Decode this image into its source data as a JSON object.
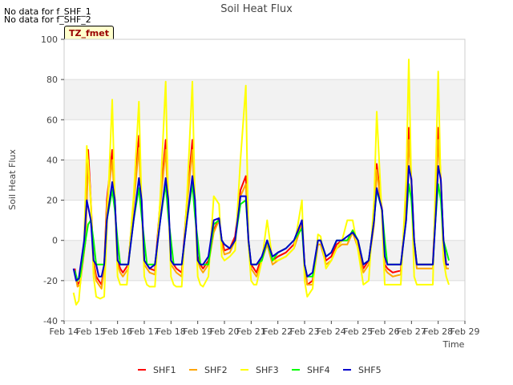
{
  "notes": [
    "No data for f_SHF_1",
    "No data for f_SHF_2"
  ],
  "badge": "TZ_fmet",
  "chart_data": {
    "type": "line",
    "title": "Soil Heat Flux",
    "xlabel": "Time",
    "ylabel": "Soil Heat Flux",
    "ylim": [
      -40,
      100
    ],
    "yticks": [
      -40,
      -20,
      0,
      20,
      40,
      60,
      80,
      100
    ],
    "xlim": [
      0,
      15
    ],
    "xticks": [
      0,
      1,
      2,
      3,
      4,
      5,
      6,
      7,
      8,
      9,
      10,
      11,
      12,
      13,
      14,
      15
    ],
    "xticklabels": [
      "Feb 14",
      "Feb 15",
      "Feb 16",
      "Feb 17",
      "Feb 18",
      "Feb 19",
      "Feb 20",
      "Feb 21",
      "Feb 22",
      "Feb 23",
      "Feb 24",
      "Feb 25",
      "Feb 26",
      "Feb 27",
      "Feb 28",
      "Feb 29"
    ],
    "grid": "horizontal bands",
    "legend_position": "bottom",
    "series": [
      {
        "name": "SHF1",
        "color": "#ff0000",
        "x": [
          0.4,
          0.5,
          0.6,
          0.8,
          0.9,
          1.0,
          1.1,
          1.2,
          1.3,
          1.4,
          1.5,
          1.6,
          1.8,
          1.9,
          2.0,
          2.1,
          2.2,
          2.4,
          2.6,
          2.8,
          2.9,
          3.0,
          3.1,
          3.2,
          3.4,
          3.6,
          3.8,
          3.9,
          4.0,
          4.1,
          4.2,
          4.4,
          4.6,
          4.8,
          4.9,
          5.0,
          5.1,
          5.2,
          5.4,
          5.6,
          5.8,
          5.9,
          6.0,
          6.2,
          6.4,
          6.6,
          6.8,
          6.9,
          7.0,
          7.1,
          7.2,
          7.4,
          7.6,
          7.8,
          8.0,
          8.3,
          8.6,
          8.9,
          9.0,
          9.1,
          9.3,
          9.5,
          9.6,
          9.8,
          10.0,
          10.2,
          10.4,
          10.6,
          10.8,
          11.0,
          11.2,
          11.4,
          11.6,
          11.7,
          11.9,
          12.0,
          12.1,
          12.3,
          12.6,
          12.8,
          12.9,
          13.0,
          13.1,
          13.2,
          13.4,
          13.6,
          13.8,
          13.9,
          14.0,
          14.1,
          14.2,
          14.3,
          14.4
        ],
        "y": [
          -14,
          -22,
          -20,
          0,
          45,
          20,
          -10,
          -18,
          -20,
          -22,
          -12,
          20,
          45,
          20,
          -10,
          -14,
          -16,
          -12,
          20,
          52,
          18,
          -10,
          -12,
          -14,
          -15,
          20,
          50,
          18,
          -10,
          -12,
          -14,
          -16,
          20,
          50,
          18,
          -8,
          -12,
          -14,
          -10,
          5,
          11,
          0,
          -5,
          -4,
          2,
          25,
          32,
          0,
          -12,
          -14,
          -16,
          -8,
          0,
          -10,
          -8,
          -6,
          -2,
          10,
          -12,
          -22,
          -20,
          0,
          0,
          -10,
          -8,
          -2,
          0,
          0,
          5,
          -2,
          -14,
          -10,
          10,
          38,
          15,
          -12,
          -14,
          -16,
          -15,
          20,
          56,
          30,
          0,
          -12,
          -12,
          -12,
          -12,
          20,
          56,
          30,
          0,
          -12,
          -12
        ]
      },
      {
        "name": "SHF2",
        "color": "#ffa500",
        "x": [
          0.4,
          0.5,
          0.6,
          0.8,
          0.9,
          1.0,
          1.1,
          1.2,
          1.3,
          1.4,
          1.5,
          1.6,
          1.8,
          1.9,
          2.0,
          2.1,
          2.2,
          2.4,
          2.6,
          2.8,
          2.9,
          3.0,
          3.1,
          3.2,
          3.4,
          3.6,
          3.8,
          3.9,
          4.0,
          4.1,
          4.2,
          4.4,
          4.6,
          4.8,
          4.9,
          5.0,
          5.1,
          5.2,
          5.4,
          5.6,
          5.8,
          5.9,
          6.0,
          6.2,
          6.4,
          6.6,
          6.8,
          6.9,
          7.0,
          7.1,
          7.2,
          7.4,
          7.6,
          7.8,
          8.0,
          8.3,
          8.6,
          8.9,
          9.0,
          9.1,
          9.3,
          9.5,
          9.6,
          9.8,
          10.0,
          10.2,
          10.4,
          10.6,
          10.8,
          11.0,
          11.2,
          11.4,
          11.6,
          11.7,
          11.9,
          12.0,
          12.1,
          12.3,
          12.6,
          12.8,
          12.9,
          13.0,
          13.1,
          13.2,
          13.4,
          13.6,
          13.8,
          13.9,
          14.0,
          14.1,
          14.2,
          14.3,
          14.4
        ],
        "y": [
          -16,
          -23,
          -22,
          0,
          40,
          18,
          -12,
          -20,
          -22,
          -24,
          -14,
          18,
          40,
          18,
          -12,
          -16,
          -18,
          -14,
          18,
          46,
          16,
          -12,
          -14,
          -16,
          -17,
          18,
          45,
          16,
          -12,
          -14,
          -16,
          -18,
          18,
          45,
          16,
          -10,
          -14,
          -16,
          -12,
          4,
          10,
          -2,
          -7,
          -6,
          0,
          22,
          28,
          -2,
          -14,
          -16,
          -18,
          -10,
          -2,
          -12,
          -10,
          -8,
          -4,
          8,
          -14,
          -22,
          -22,
          -2,
          -2,
          -12,
          -10,
          -4,
          -2,
          -2,
          4,
          -4,
          -16,
          -12,
          8,
          35,
          13,
          -14,
          -16,
          -18,
          -17,
          18,
          50,
          27,
          -2,
          -14,
          -14,
          -14,
          -14,
          18,
          50,
          27,
          -2,
          -14,
          -14
        ]
      },
      {
        "name": "SHF3",
        "color": "#ffff00",
        "x": [
          0.35,
          0.45,
          0.55,
          0.75,
          0.85,
          1.0,
          1.1,
          1.2,
          1.35,
          1.5,
          1.65,
          1.8,
          1.9,
          2.0,
          2.1,
          2.2,
          2.35,
          2.6,
          2.8,
          2.9,
          3.0,
          3.1,
          3.2,
          3.4,
          3.6,
          3.8,
          3.9,
          4.0,
          4.1,
          4.2,
          4.4,
          4.6,
          4.8,
          4.9,
          5.0,
          5.1,
          5.2,
          5.4,
          5.6,
          5.8,
          5.9,
          6.0,
          6.2,
          6.4,
          6.6,
          6.8,
          6.9,
          7.0,
          7.1,
          7.2,
          7.4,
          7.6,
          7.8,
          8.0,
          8.3,
          8.6,
          8.9,
          9.0,
          9.1,
          9.3,
          9.5,
          9.6,
          9.8,
          10.0,
          10.2,
          10.4,
          10.6,
          10.8,
          11.0,
          11.2,
          11.4,
          11.6,
          11.7,
          11.9,
          12.0,
          12.1,
          12.3,
          12.6,
          12.8,
          12.9,
          13.0,
          13.1,
          13.2,
          13.4,
          13.6,
          13.8,
          13.9,
          14.0,
          14.1,
          14.2,
          14.3,
          14.4
        ],
        "y": [
          -26,
          -32,
          -30,
          0,
          47,
          20,
          -18,
          -28,
          -29,
          -28,
          22,
          70,
          20,
          -18,
          -22,
          -22,
          -22,
          22,
          69,
          18,
          -18,
          -22,
          -23,
          -23,
          22,
          79,
          18,
          -18,
          -22,
          -23,
          -23,
          22,
          79,
          18,
          -18,
          -22,
          -23,
          -18,
          22,
          18,
          -8,
          -10,
          -8,
          -5,
          40,
          77,
          -2,
          -20,
          -22,
          -22,
          -10,
          10,
          -10,
          -10,
          -8,
          -4,
          20,
          -20,
          -28,
          -24,
          3,
          2,
          -14,
          -10,
          -4,
          0,
          10,
          10,
          -5,
          -22,
          -20,
          20,
          64,
          10,
          -22,
          -22,
          -22,
          -22,
          30,
          90,
          25,
          -18,
          -22,
          -22,
          -22,
          -22,
          30,
          84,
          25,
          -10,
          -18,
          -22
        ]
      },
      {
        "name": "SHF4",
        "color": "#00ff00",
        "x": [
          0.4,
          0.5,
          0.6,
          0.8,
          0.9,
          1.0,
          1.1,
          1.2,
          1.3,
          1.4,
          1.5,
          1.6,
          1.8,
          1.9,
          2.0,
          2.1,
          2.2,
          2.4,
          2.6,
          2.8,
          2.9,
          3.0,
          3.1,
          3.2,
          3.4,
          3.6,
          3.8,
          3.9,
          4.0,
          4.1,
          4.2,
          4.4,
          4.6,
          4.8,
          4.9,
          5.0,
          5.1,
          5.2,
          5.4,
          5.6,
          5.8,
          5.9,
          6.0,
          6.2,
          6.4,
          6.6,
          6.8,
          6.9,
          7.0,
          7.1,
          7.2,
          7.4,
          7.6,
          7.8,
          8.0,
          8.3,
          8.6,
          8.9,
          9.0,
          9.1,
          9.3,
          9.5,
          9.6,
          9.8,
          10.0,
          10.2,
          10.4,
          10.6,
          10.8,
          11.0,
          11.2,
          11.4,
          11.6,
          11.7,
          11.9,
          12.0,
          12.1,
          12.3,
          12.6,
          12.8,
          12.9,
          13.0,
          13.1,
          13.2,
          13.4,
          13.6,
          13.8,
          13.9,
          14.0,
          14.1,
          14.2,
          14.3,
          14.4
        ],
        "y": [
          -15,
          -20,
          -18,
          0,
          8,
          10,
          0,
          -12,
          -12,
          -12,
          -12,
          10,
          25,
          15,
          0,
          -12,
          -12,
          -12,
          10,
          26,
          12,
          0,
          -12,
          -12,
          -12,
          10,
          28,
          12,
          0,
          -12,
          -12,
          -12,
          10,
          28,
          12,
          0,
          -12,
          -12,
          -12,
          8,
          10,
          0,
          -2,
          -4,
          0,
          18,
          20,
          0,
          -12,
          -12,
          -12,
          -10,
          0,
          -10,
          -6,
          -4,
          0,
          6,
          -12,
          -18,
          -18,
          0,
          0,
          -8,
          -6,
          0,
          0,
          0,
          5,
          0,
          -12,
          -10,
          10,
          25,
          15,
          0,
          -12,
          -12,
          -12,
          10,
          28,
          20,
          0,
          -12,
          -12,
          -12,
          -12,
          10,
          28,
          20,
          0,
          -5,
          -10
        ]
      },
      {
        "name": "SHF5",
        "color": "#0000cc",
        "x": [
          0.35,
          0.45,
          0.55,
          0.75,
          0.85,
          1.0,
          1.1,
          1.2,
          1.3,
          1.4,
          1.5,
          1.6,
          1.8,
          1.9,
          2.0,
          2.1,
          2.2,
          2.4,
          2.6,
          2.8,
          2.9,
          3.0,
          3.1,
          3.2,
          3.4,
          3.6,
          3.8,
          3.9,
          4.0,
          4.1,
          4.2,
          4.4,
          4.6,
          4.8,
          4.9,
          5.0,
          5.1,
          5.2,
          5.4,
          5.6,
          5.8,
          5.9,
          6.0,
          6.2,
          6.4,
          6.6,
          6.8,
          6.9,
          7.0,
          7.1,
          7.2,
          7.4,
          7.6,
          7.8,
          8.0,
          8.3,
          8.6,
          8.9,
          9.0,
          9.1,
          9.3,
          9.5,
          9.6,
          9.8,
          10.0,
          10.2,
          10.4,
          10.6,
          10.8,
          11.0,
          11.2,
          11.4,
          11.6,
          11.7,
          11.9,
          12.0,
          12.1,
          12.3,
          12.6,
          12.8,
          12.9,
          13.0,
          13.1,
          13.2,
          13.4,
          13.6,
          13.8,
          13.9,
          14.0,
          14.1,
          14.2,
          14.3,
          14.4
        ],
        "y": [
          -14,
          -20,
          -19,
          0,
          20,
          10,
          -10,
          -12,
          -18,
          -18,
          -12,
          10,
          29,
          20,
          -10,
          -12,
          -12,
          -12,
          10,
          31,
          20,
          -10,
          -12,
          -14,
          -12,
          10,
          31,
          20,
          -10,
          -12,
          -12,
          -12,
          10,
          32,
          20,
          -10,
          -12,
          -12,
          -8,
          10,
          11,
          0,
          -2,
          -4,
          0,
          22,
          22,
          0,
          -12,
          -12,
          -12,
          -8,
          0,
          -8,
          -6,
          -4,
          0,
          10,
          -12,
          -18,
          -16,
          0,
          0,
          -8,
          -6,
          0,
          0,
          2,
          4,
          0,
          -12,
          -10,
          10,
          26,
          15,
          -8,
          -12,
          -12,
          -12,
          10,
          37,
          30,
          0,
          -12,
          -12,
          -12,
          -12,
          10,
          37,
          30,
          0,
          -12,
          -12
        ]
      }
    ]
  }
}
